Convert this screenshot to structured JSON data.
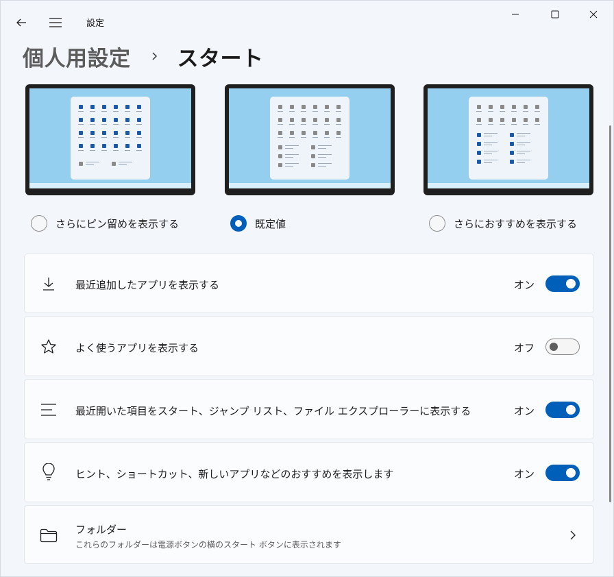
{
  "window": {
    "title": "設定",
    "accent_color": "#005fb8"
  },
  "breadcrumb": {
    "parent": "個人用設定",
    "current": "スタート"
  },
  "layout_options": [
    {
      "label": "さらにピン留めを表示する",
      "selected": false
    },
    {
      "label": "既定値",
      "selected": true
    },
    {
      "label": "さらにおすすめを表示する",
      "selected": false
    }
  ],
  "settings": [
    {
      "label": "最近追加したアプリを表示する",
      "icon": "download-icon",
      "state": "オン",
      "on": true
    },
    {
      "label": "よく使うアプリを表示する",
      "icon": "star-icon",
      "state": "オフ",
      "on": false
    },
    {
      "label": "最近開いた項目をスタート、ジャンプ リスト、ファイル エクスプローラーに表示する",
      "icon": "list-icon",
      "state": "オン",
      "on": true
    },
    {
      "label": "ヒント、ショートカット、新しいアプリなどのおすすめを表示します",
      "icon": "lightbulb-icon",
      "state": "オン",
      "on": true
    }
  ],
  "folders": {
    "label": "フォルダー",
    "description": "これらのフォルダーは電源ボタンの横のスタート ボタンに表示されます",
    "icon": "folder-icon"
  }
}
